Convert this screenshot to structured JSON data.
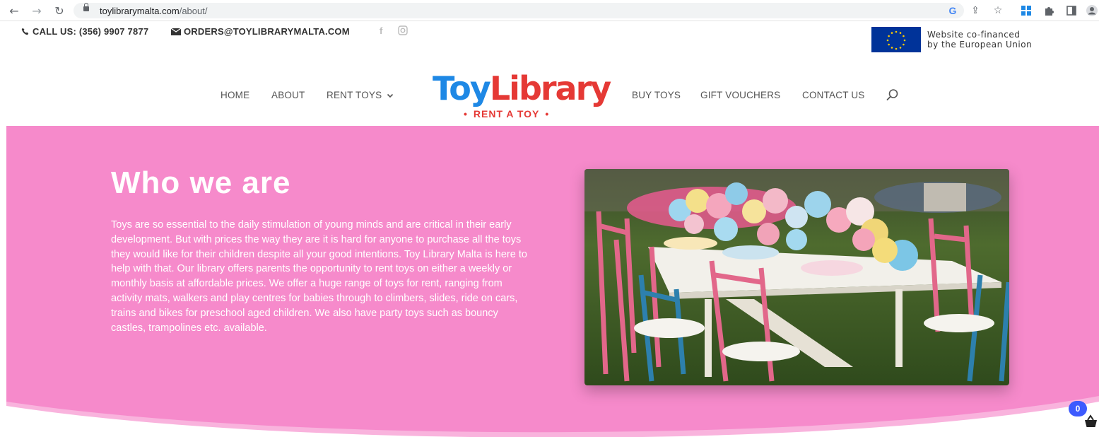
{
  "browser": {
    "url_domain": "toylibrarymalta.com",
    "url_path": "/about/"
  },
  "topbar": {
    "phone": "CALL US: (356) 9907 7877",
    "email": "ORDERS@TOYLIBRARYMALTA.COM",
    "eu_line1": "Website co-financed",
    "eu_line2": "by the European Union"
  },
  "nav": {
    "left": [
      "HOME",
      "ABOUT",
      "RENT TOYS"
    ],
    "right": [
      "BUY TOYS",
      "GIFT VOUCHERS",
      "CONTACT US"
    ]
  },
  "logo": {
    "title_part1": "Toy",
    "title_part2": "Library",
    "subtitle": "RENT A TOY"
  },
  "hero": {
    "title": "Who we are",
    "paragraph": "Toys are so essential to the daily stimulation of young minds and are critical in their early development. But with prices the way they are it is hard for anyone to purchase all the toys they would like for their children despite all your good intentions. Toy Library Malta is here to help with that. Our library offers parents the opportunity to rent toys on either a weekly or monthly basis at affordable prices. We offer a huge range of toys for rent, ranging from activity mats, walkers and play centres for babies through to climbers, slides, ride on cars, trains and bikes for preschool aged children. We also have party toys such as bouncy castles, trampolines etc. available."
  },
  "cart": {
    "count": "0"
  },
  "colors": {
    "hero_bg": "#f68acb",
    "logo_red": "#e53935",
    "eu_blue": "#003399",
    "cart_badge": "#3d5afe"
  }
}
